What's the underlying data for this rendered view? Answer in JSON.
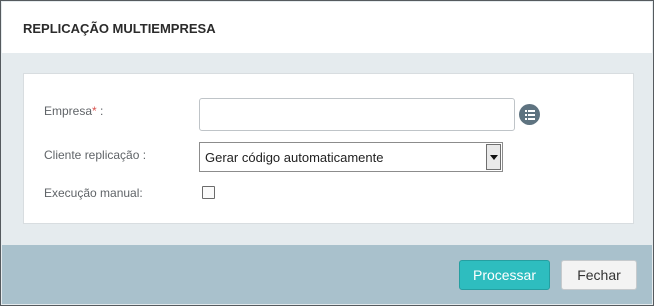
{
  "dialog": {
    "title": "REPLICAÇÃO MULTIEMPRESA"
  },
  "form": {
    "empresa": {
      "label": "Empresa",
      "required_marker": "*",
      "label_suffix": " :",
      "value": "",
      "lookup_icon": "list-icon"
    },
    "cliente_replicacao": {
      "label": "Cliente replicação :",
      "selected": "Gerar código automaticamente"
    },
    "execucao_manual": {
      "label": "Execução manual:",
      "checked": false
    }
  },
  "footer": {
    "process_label": "Processar",
    "close_label": "Fechar"
  },
  "colors": {
    "primary_button": "#2ebdbf",
    "footer_bg": "#a9c1cc",
    "required": "#d9534f"
  }
}
